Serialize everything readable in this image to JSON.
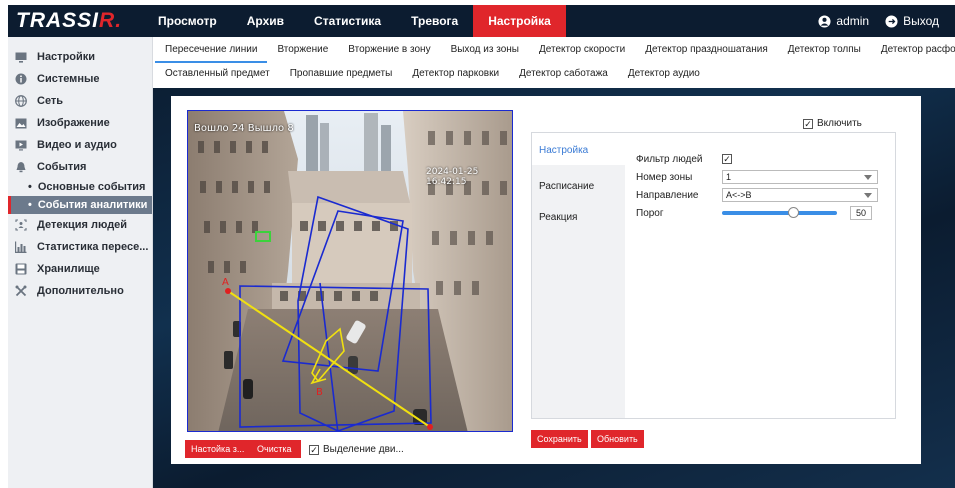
{
  "app": {
    "logo_main": "TRASSI",
    "logo_accent": "R",
    "logo_tail": "."
  },
  "nav": {
    "items": [
      {
        "label": "Просмотр"
      },
      {
        "label": "Архив"
      },
      {
        "label": "Статистика"
      },
      {
        "label": "Тревога"
      },
      {
        "label": "Настройка"
      }
    ],
    "active_index": 4
  },
  "user": {
    "name": "admin",
    "logout_label": "Выход"
  },
  "sidebar": {
    "items": [
      {
        "label": "Настройки",
        "icon": "monitor-icon"
      },
      {
        "label": "Системные",
        "icon": "info-icon"
      },
      {
        "label": "Сеть",
        "icon": "globe-icon"
      },
      {
        "label": "Изображение",
        "icon": "image-icon"
      },
      {
        "label": "Видео и аудио",
        "icon": "video-icon"
      },
      {
        "label": "События",
        "icon": "bell-icon"
      }
    ],
    "sub_items": [
      {
        "label": "Основные события"
      },
      {
        "label": "События аналитики"
      }
    ],
    "items_after": [
      {
        "label": "Детекция людей",
        "icon": "people-detect-icon"
      },
      {
        "label": "Статистика пересе...",
        "icon": "chart-icon"
      },
      {
        "label": "Хранилище",
        "icon": "storage-icon"
      },
      {
        "label": "Дополнительно",
        "icon": "tools-icon"
      }
    ]
  },
  "tabs": {
    "row1": [
      {
        "label": "Пересечение линии"
      },
      {
        "label": "Вторжение"
      },
      {
        "label": "Вторжение в зону"
      },
      {
        "label": "Выход из зоны"
      },
      {
        "label": "Детектор скорости"
      },
      {
        "label": "Детектор праздношатания"
      },
      {
        "label": "Детектор толпы"
      },
      {
        "label": "Детектор расфокусировки"
      }
    ],
    "row2": [
      {
        "label": "Оставленный предмет"
      },
      {
        "label": "Пропавшие предметы"
      },
      {
        "label": "Детектор парковки"
      },
      {
        "label": "Детектор саботажа"
      },
      {
        "label": "Детектор аудио"
      }
    ]
  },
  "video": {
    "osd_left": "Вошло 24  Вышло 8",
    "osd_right": "2024-01-25 16:42:15",
    "label_a": "A",
    "label_b": "B"
  },
  "buttons": {
    "zone_setup": "Настойка з...",
    "clear": "Очистка",
    "motion_highlight": "Выделение дви...",
    "save": "Сохранить",
    "refresh": "Обновить"
  },
  "enable": {
    "label": "Включить",
    "checked": true
  },
  "settings": {
    "tabs": [
      {
        "label": "Настройка"
      },
      {
        "label": "Расписание"
      },
      {
        "label": "Реакция"
      }
    ],
    "people_filter_label": "Фильтр людей",
    "people_filter_checked": true,
    "zone_label": "Номер зоны",
    "zone_value": "1",
    "direction_label": "Направление",
    "direction_value": "A<->B",
    "threshold_label": "Порог",
    "threshold_value": "50"
  }
}
